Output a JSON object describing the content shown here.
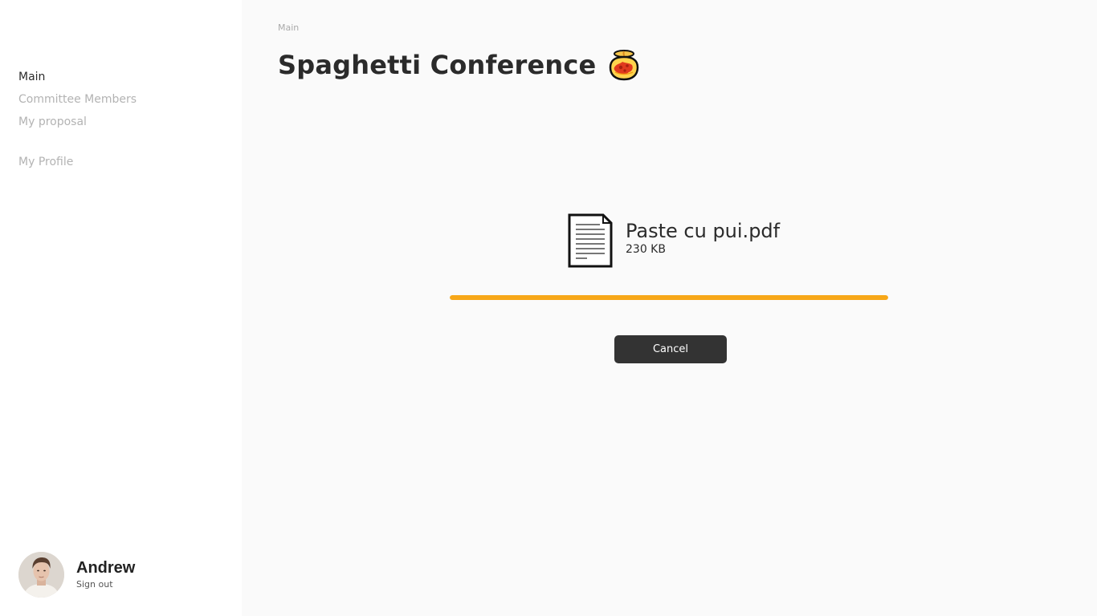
{
  "sidebar": {
    "items": [
      {
        "label": "Main",
        "active": true
      },
      {
        "label": "Committee Members",
        "active": false
      },
      {
        "label": "My proposal",
        "active": false
      }
    ],
    "profile_link": "My Profile",
    "user": {
      "name": "Andrew",
      "signout_label": "Sign out"
    }
  },
  "header": {
    "breadcrumb": "Main",
    "title": "Spaghetti Conference",
    "title_icon": "spaghetti-emoji"
  },
  "upload": {
    "file_name": "Paste cu pui.pdf",
    "file_size": "230 KB",
    "file_icon": "document-icon",
    "progress_fraction": 1.0,
    "progress_color": "#f7a718",
    "cancel_label": "Cancel"
  },
  "colors": {
    "accent": "#f7a718",
    "button_bg": "#333333",
    "main_bg": "#fafafa",
    "nav_inactive": "#b3b3b3"
  }
}
